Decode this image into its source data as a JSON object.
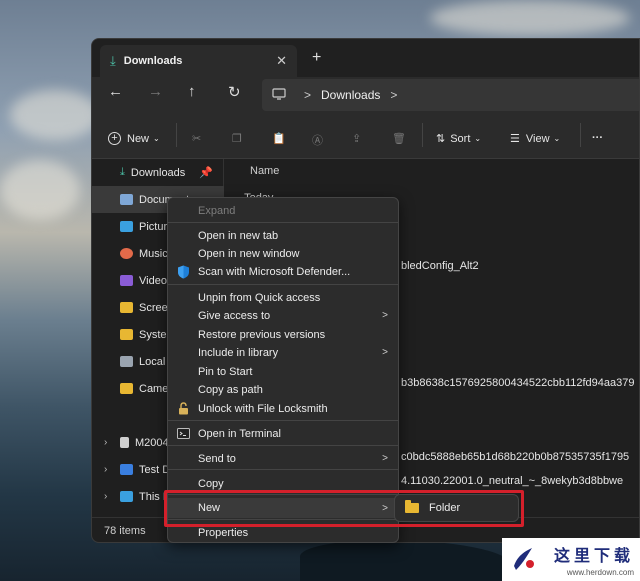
{
  "window": {
    "tab_title": "Downloads",
    "tab_close": "✕",
    "new_tab": "+"
  },
  "nav": {
    "back": "←",
    "forward": "→",
    "up": "↑",
    "refresh": "↻",
    "address_path": "Downloads",
    "address_chevron": ">"
  },
  "toolbar": {
    "new_label": "New",
    "sort_label": "Sort",
    "view_label": "View",
    "more": "···"
  },
  "sidebar": {
    "items": [
      {
        "label": "Downloads",
        "color": "#4cc2a8",
        "pinned": true
      },
      {
        "label": "Documents",
        "color": "#7fa7d6"
      },
      {
        "label": "Pictures",
        "color": "#3aa0e0"
      },
      {
        "label": "Music",
        "color": "#e26a4a"
      },
      {
        "label": "Videos",
        "color": "#8a5cd6"
      },
      {
        "label": "Screenshots",
        "color": "#e8b732"
      },
      {
        "label": "System",
        "color": "#e8b732"
      },
      {
        "label": "Local Disk",
        "color": "#9aa4b0"
      },
      {
        "label": "Camera",
        "color": "#e8b732"
      },
      {
        "label": "M2004",
        "color": "#cfcfcf"
      },
      {
        "label": "Test Drive",
        "color": "#3a7fe0"
      },
      {
        "label": "This PC",
        "color": "#3aa0e0"
      }
    ]
  },
  "content": {
    "column_name": "Name",
    "group_today": "Today",
    "file_fragments": [
      "bledConfig_Alt2",
      "b3b8638c1576925800434522cbb112fd94aa379",
      "c0bdc5888eb65b1d68b220b0b87535735f1795",
      "4.11030.22001.0_neutral_~_8wekyb3d8bbwe"
    ]
  },
  "status": {
    "item_count": "78 items"
  },
  "context_menu": {
    "items": [
      {
        "label": "Expand",
        "disabled": true
      },
      {
        "label": "Open in new tab"
      },
      {
        "label": "Open in new window"
      },
      {
        "label": "Scan with Microsoft Defender...",
        "icon": "defender-shield-icon"
      },
      {
        "label": "Unpin from Quick access"
      },
      {
        "label": "Give access to",
        "submenu": true
      },
      {
        "label": "Restore previous versions"
      },
      {
        "label": "Include in library",
        "submenu": true
      },
      {
        "label": "Pin to Start"
      },
      {
        "label": "Copy as path"
      },
      {
        "label": "Unlock with File Locksmith",
        "icon": "lock-icon"
      },
      {
        "label": "Open in Terminal",
        "icon": "terminal-icon"
      },
      {
        "label": "Send to",
        "submenu": true
      },
      {
        "label": "Copy"
      },
      {
        "label": "New",
        "submenu": true,
        "highlighted": true
      },
      {
        "label": "Properties"
      }
    ],
    "arrow": ">"
  },
  "submenu_new": {
    "folder_label": "Folder"
  },
  "watermark": {
    "text": "这里下载",
    "domain": "www.herdown.com"
  },
  "colors": {
    "accent": "#4cc2a8",
    "highlight_border": "#d4202b",
    "folder": "#e8b732"
  }
}
